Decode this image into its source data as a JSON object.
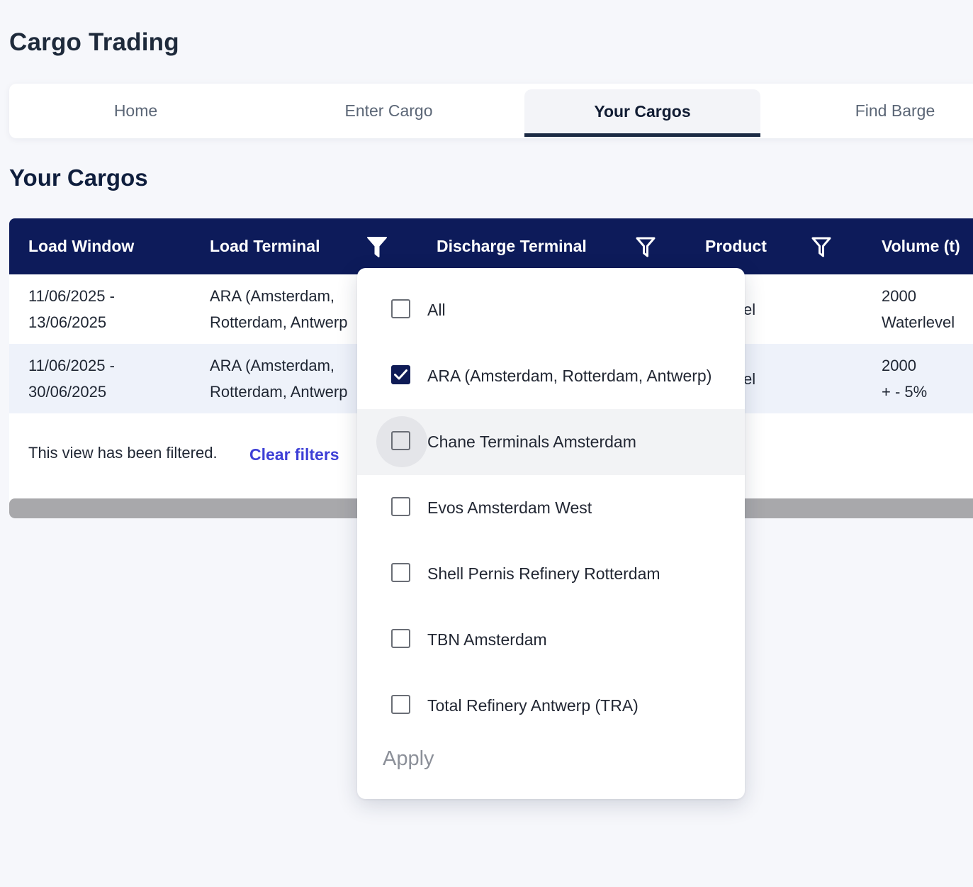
{
  "app": {
    "title": "Cargo Trading"
  },
  "tabs": [
    {
      "label": "Home",
      "active": false
    },
    {
      "label": "Enter Cargo",
      "active": false
    },
    {
      "label": "Your Cargos",
      "active": true
    },
    {
      "label": "Find Barge",
      "active": false
    }
  ],
  "page": {
    "title": "Your Cargos"
  },
  "table": {
    "columns": [
      "Load Window",
      "Load Terminal",
      "Discharge Terminal",
      "Product",
      "Volume (t)"
    ],
    "filter_icon": "filter-funnel-icon",
    "rows": [
      {
        "load_window": [
          "11/06/2025 -",
          "13/06/2025"
        ],
        "load_terminal": [
          "ARA (Amsterdam,",
          "Rotterdam, Antwerp"
        ],
        "product_fragment": "el",
        "volume": [
          "2000",
          "Waterlevel"
        ]
      },
      {
        "load_window": [
          "11/06/2025 -",
          "30/06/2025"
        ],
        "load_terminal": [
          "ARA (Amsterdam,",
          "Rotterdam, Antwerp"
        ],
        "product_fragment": "el",
        "volume": [
          "2000",
          "+ - 5%"
        ]
      }
    ],
    "filter_note": "This view has been filtered.",
    "clear_filters": "Clear filters"
  },
  "filter_dropdown": {
    "options": [
      {
        "label": "All",
        "checked": false
      },
      {
        "label": "ARA (Amsterdam, Rotterdam, Antwerp)",
        "checked": true
      },
      {
        "label": "Chane Terminals Amsterdam",
        "checked": false,
        "hover": true
      },
      {
        "label": "Evos Amsterdam West",
        "checked": false
      },
      {
        "label": "Shell Pernis Refinery Rotterdam",
        "checked": false
      },
      {
        "label": "TBN Amsterdam",
        "checked": false
      },
      {
        "label": "Total Refinery Antwerp (TRA)",
        "checked": false
      }
    ],
    "apply_label": "Apply"
  },
  "colors": {
    "header_bg": "#0d1b5a",
    "accent_link": "#3d3fd6",
    "checkbox_checked": "#0f1b56",
    "row_alt": "#eef2fa"
  }
}
